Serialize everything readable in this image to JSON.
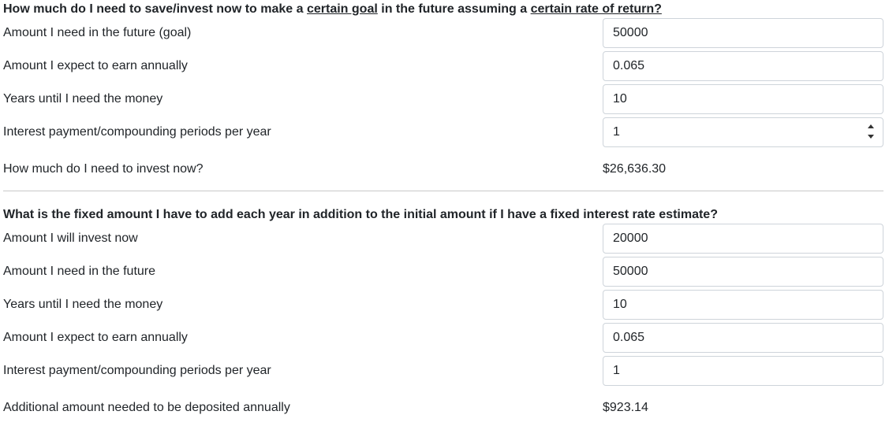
{
  "section1": {
    "title_prefix": "How much do I need to save/invest now to make a ",
    "title_link1": "certain goal",
    "title_middle": " in the future assuming a ",
    "title_link2": "certain rate of return?",
    "fields": [
      {
        "label": "Amount I need in the future (goal)",
        "value": "50000"
      },
      {
        "label": "Amount I expect to earn annually",
        "value": "0.065"
      },
      {
        "label": "Years until I need the money",
        "value": "10"
      },
      {
        "label": "Interest payment/compounding periods per year",
        "value": "1"
      }
    ],
    "result_label": "How much do I need to invest now?",
    "result_value": "$26,636.30"
  },
  "section2": {
    "title": "What is the fixed amount I have to add each year in addition to the initial amount if I have a fixed interest rate estimate?",
    "fields": [
      {
        "label": "Amount I will invest now",
        "value": "20000"
      },
      {
        "label": "Amount I need in the future",
        "value": "50000"
      },
      {
        "label": "Years until I need the money",
        "value": "10"
      },
      {
        "label": "Amount I expect to earn annually",
        "value": "0.065"
      },
      {
        "label": "Interest payment/compounding periods per year",
        "value": "1"
      }
    ],
    "result_label": "Additional amount needed to be deposited annually",
    "result_value": "$923.14"
  },
  "icons": {
    "spinner": "number-spinner-icon"
  }
}
